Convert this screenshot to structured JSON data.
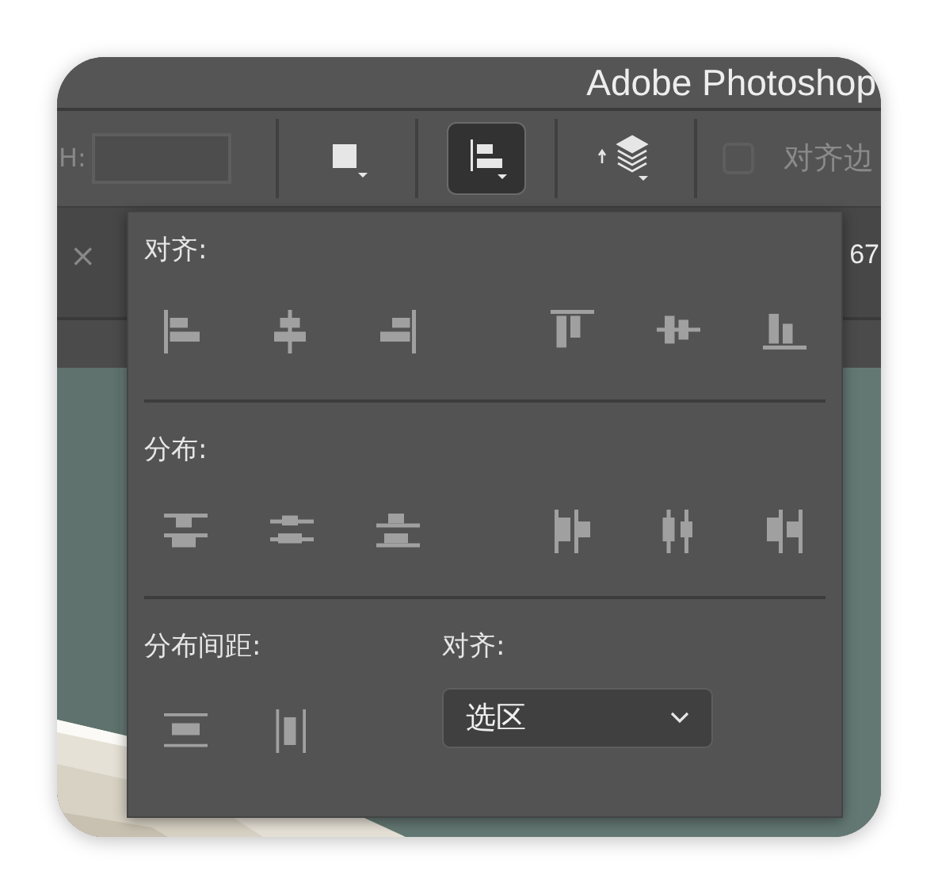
{
  "window": {
    "title": "Adobe Photoshop"
  },
  "toolbar": {
    "height_label": "H:",
    "tools": [
      {
        "kind": "fill",
        "selected": false
      },
      {
        "kind": "align",
        "selected": true
      },
      {
        "kind": "arrange",
        "selected": false
      }
    ],
    "checkbox": {
      "label": "对齐边",
      "checked": false
    }
  },
  "document_tab": {
    "close": "×",
    "title": "67"
  },
  "align_panel": {
    "align_label": "对齐:",
    "align_buttons": [
      {
        "kind": "left"
      },
      {
        "kind": "hcenter"
      },
      {
        "kind": "right"
      },
      {
        "kind": "top"
      },
      {
        "kind": "vcenter"
      },
      {
        "kind": "bottom"
      }
    ],
    "distribute_label": "分布:",
    "distribute_buttons": [
      {
        "kind": "dtop"
      },
      {
        "kind": "dvcenter"
      },
      {
        "kind": "dbottom"
      },
      {
        "kind": "dleft"
      },
      {
        "kind": "dhcenter"
      },
      {
        "kind": "dright"
      }
    ],
    "spacing_label": "分布间距:",
    "spacing_buttons": [
      {
        "kind": "vspace"
      },
      {
        "kind": "hspace"
      }
    ],
    "align_to_label": "对齐:",
    "align_to": {
      "value": "选区"
    }
  }
}
